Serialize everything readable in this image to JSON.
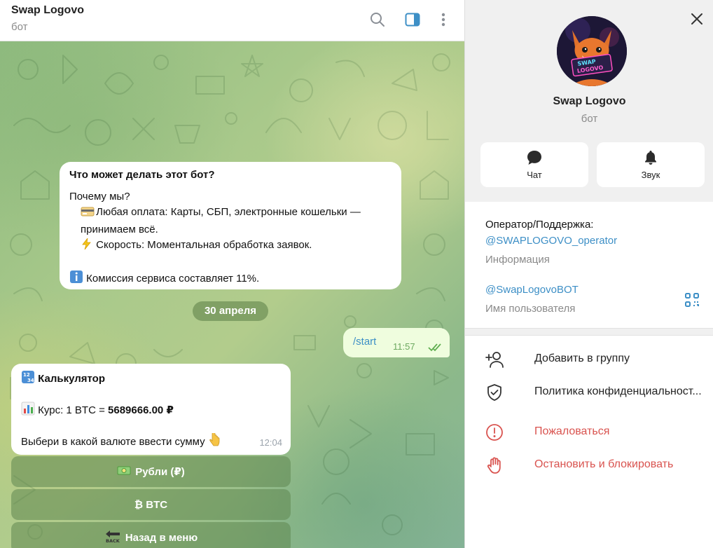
{
  "header": {
    "title": "Swap Logovo",
    "subtitle": "бот",
    "icons": [
      "search-icon",
      "sidebar-toggle-icon",
      "more-vertical-icon"
    ]
  },
  "bot_info": {
    "title": "Что может делать этот бот?",
    "line1": "Почему мы?",
    "line2": "Любая оплата: Карты, СБП, электронные кошельки — принимаем всё.",
    "line3": "Скорость: Моментальная обработка заявок.",
    "line4": "Комиссия сервиса составляет 11%."
  },
  "date_pill": "30 апреля",
  "outgoing": {
    "text": "/start",
    "time": "11:57"
  },
  "calc_msg": {
    "title": "Калькулятор",
    "rate_prefix": "Курс: 1 BTC = ",
    "rate_value": "5689666.00 ₽",
    "prompt": "Выбери в какой валюте ввести сумму",
    "time": "12:04"
  },
  "keyboard": [
    {
      "label": "Рубли (₽)",
      "icon": "money-icon"
    },
    {
      "label": "₿ BTC",
      "icon": ""
    },
    {
      "label": "Назад в меню",
      "icon": "back-icon"
    }
  ],
  "panel": {
    "name": "Swap Logovo",
    "subtitle": "бот",
    "actions": [
      {
        "label": "Чат",
        "icon": "chat-icon"
      },
      {
        "label": "Звук",
        "icon": "bell-icon"
      }
    ],
    "info": {
      "description": "Оператор/Поддержка:",
      "description_link": "@SWAPLOGOVO_operator",
      "description_caption": "Информация",
      "username": "@SwapLogovoBOT",
      "username_caption": "Имя пользователя"
    },
    "menu": [
      {
        "label": "Добавить в группу",
        "icon": "add-user-icon",
        "danger": false
      },
      {
        "label": "Политика конфиденциальност...",
        "icon": "shield-check-icon",
        "danger": false
      },
      {
        "label": "Пожаловаться",
        "icon": "alert-circle-icon",
        "danger": true
      },
      {
        "label": "Остановить и блокировать",
        "icon": "hand-stop-icon",
        "danger": true
      }
    ]
  },
  "colors": {
    "link": "#3d8fc6",
    "danger": "#d9534f",
    "outgoing_bubble": "#effdde",
    "accent": "#3d8fc6"
  }
}
